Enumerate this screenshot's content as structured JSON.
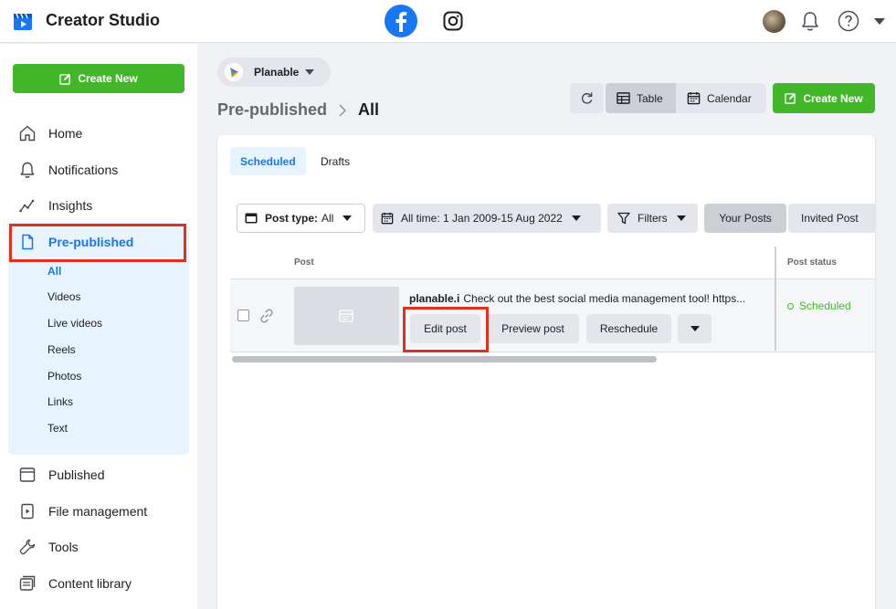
{
  "app": {
    "title": "Creator Studio"
  },
  "header": {
    "platforms": [
      "facebook-icon",
      "instagram-icon"
    ],
    "icons": [
      "avatar",
      "bell-icon",
      "help-icon",
      "chevron-down-icon"
    ]
  },
  "sidebar": {
    "create_label": "Create New",
    "items": [
      {
        "label": "Home",
        "icon": "home-icon"
      },
      {
        "label": "Notifications",
        "icon": "bell-icon"
      },
      {
        "label": "Insights",
        "icon": "insights-icon"
      },
      {
        "label": "Pre-published",
        "icon": "document-icon",
        "active": true
      },
      {
        "label": "Published",
        "icon": "published-icon"
      },
      {
        "label": "File management",
        "icon": "file-icon"
      },
      {
        "label": "Tools",
        "icon": "wrench-icon"
      },
      {
        "label": "Content library",
        "icon": "library-icon"
      }
    ],
    "subitems": [
      "All",
      "Videos",
      "Live videos",
      "Reels",
      "Photos",
      "Links",
      "Text"
    ]
  },
  "page_selector": {
    "label": "Planable"
  },
  "breadcrumb": {
    "parent": "Pre-published",
    "current": "All"
  },
  "toolbar": {
    "table_label": "Table",
    "calendar_label": "Calendar",
    "create_label": "Create New"
  },
  "tabs": {
    "scheduled": "Scheduled",
    "drafts": "Drafts"
  },
  "filters": {
    "post_type_label": "Post type:",
    "post_type_value": "All",
    "time_label": "All time: 1 Jan 2009-15 Aug 2022",
    "filters_label": "Filters",
    "your_posts": "Your Posts",
    "invited_posts": "Invited Post"
  },
  "table": {
    "columns": {
      "post": "Post",
      "status": "Post status"
    },
    "rows": [
      {
        "author": "planable.i",
        "text": "Check out the best social media management tool! https...",
        "actions": {
          "edit": "Edit post",
          "preview": "Preview post",
          "reschedule": "Reschedule"
        },
        "status": "Scheduled"
      }
    ]
  },
  "colors": {
    "accent": "#1877f2",
    "green": "#42b72a",
    "highlight": "#e0301e"
  }
}
